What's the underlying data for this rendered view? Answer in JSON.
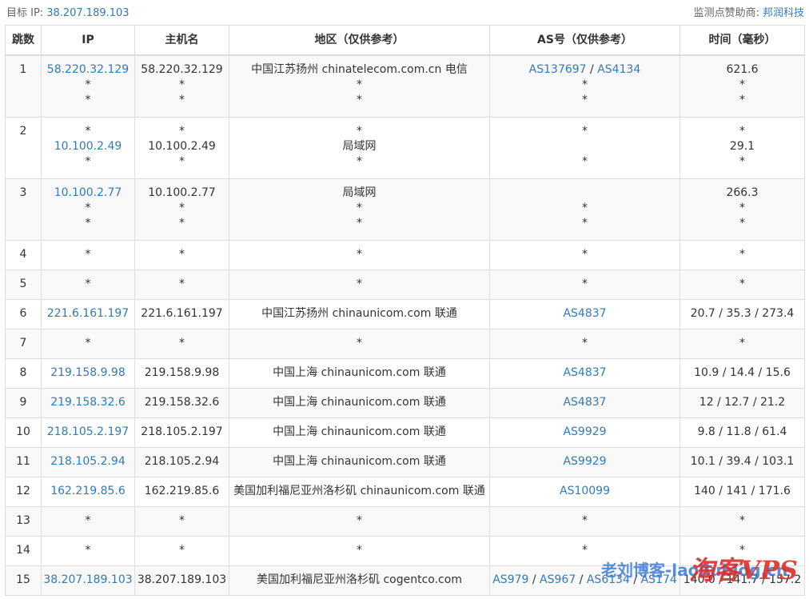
{
  "header": {
    "target_label": "目标 IP:",
    "target_ip": "38.207.189.103",
    "sponsor_label": "监测点赞助商:",
    "sponsor_name": "邦润科技"
  },
  "table": {
    "columns": [
      "跳数",
      "IP",
      "主机名",
      "地区（仅供参考）",
      "AS号（仅供参考）",
      "时间（毫秒）"
    ],
    "rows": [
      {
        "hop": "1",
        "tall": true,
        "ip": [
          {
            "t": "58.220.32.129",
            "l": true
          },
          {
            "t": "*"
          },
          {
            "t": "*"
          }
        ],
        "host": [
          "58.220.32.129",
          "*",
          "*"
        ],
        "region": [
          "中国江苏扬州 chinatelecom.com.cn 电信",
          "*",
          "*"
        ],
        "as": [
          [
            {
              "t": "AS137697",
              "l": true
            },
            {
              "t": "AS4134",
              "l": true
            }
          ],
          [
            {
              "t": "*"
            }
          ],
          [
            {
              "t": "*"
            }
          ]
        ],
        "time": [
          "621.6",
          "*",
          "*"
        ]
      },
      {
        "hop": "2",
        "tall": true,
        "ip": [
          {
            "t": "*"
          },
          {
            "t": "10.100.2.49",
            "l": true
          },
          {
            "t": "*"
          }
        ],
        "host": [
          "*",
          "10.100.2.49",
          "*"
        ],
        "region": [
          "*",
          "局域网",
          "*"
        ],
        "as": [
          [
            {
              "t": "*"
            }
          ],
          [
            {
              "t": ""
            }
          ],
          [
            {
              "t": "*"
            }
          ]
        ],
        "time": [
          "*",
          "29.1",
          "*"
        ]
      },
      {
        "hop": "3",
        "tall": true,
        "ip": [
          {
            "t": "10.100.2.77",
            "l": true
          },
          {
            "t": "*"
          },
          {
            "t": "*"
          }
        ],
        "host": [
          "10.100.2.77",
          "*",
          "*"
        ],
        "region": [
          "局域网",
          "*",
          "*"
        ],
        "as": [
          [
            {
              "t": ""
            }
          ],
          [
            {
              "t": "*"
            }
          ],
          [
            {
              "t": "*"
            }
          ]
        ],
        "time": [
          "266.3",
          "*",
          "*"
        ]
      },
      {
        "hop": "4",
        "ip": [
          {
            "t": "*"
          }
        ],
        "host": [
          "*"
        ],
        "region": [
          "*"
        ],
        "as": [
          [
            {
              "t": "*"
            }
          ]
        ],
        "time": [
          "*"
        ]
      },
      {
        "hop": "5",
        "ip": [
          {
            "t": "*"
          }
        ],
        "host": [
          "*"
        ],
        "region": [
          "*"
        ],
        "as": [
          [
            {
              "t": "*"
            }
          ]
        ],
        "time": [
          "*"
        ]
      },
      {
        "hop": "6",
        "ip": [
          {
            "t": "221.6.161.197",
            "l": true
          }
        ],
        "host": [
          "221.6.161.197"
        ],
        "region": [
          "中国江苏扬州 chinaunicom.com 联通"
        ],
        "as": [
          [
            {
              "t": "AS4837",
              "l": true
            }
          ]
        ],
        "time": [
          "20.7 / 35.3 / 273.4"
        ]
      },
      {
        "hop": "7",
        "ip": [
          {
            "t": "*"
          }
        ],
        "host": [
          "*"
        ],
        "region": [
          "*"
        ],
        "as": [
          [
            {
              "t": "*"
            }
          ]
        ],
        "time": [
          "*"
        ]
      },
      {
        "hop": "8",
        "ip": [
          {
            "t": "219.158.9.98",
            "l": true
          }
        ],
        "host": [
          "219.158.9.98"
        ],
        "region": [
          "中国上海 chinaunicom.com 联通"
        ],
        "as": [
          [
            {
              "t": "AS4837",
              "l": true
            }
          ]
        ],
        "time": [
          "10.9 / 14.4 / 15.6"
        ]
      },
      {
        "hop": "9",
        "ip": [
          {
            "t": "219.158.32.6",
            "l": true
          }
        ],
        "host": [
          "219.158.32.6"
        ],
        "region": [
          "中国上海 chinaunicom.com 联通"
        ],
        "as": [
          [
            {
              "t": "AS4837",
              "l": true
            }
          ]
        ],
        "time": [
          "12 / 12.7 / 21.2"
        ]
      },
      {
        "hop": "10",
        "ip": [
          {
            "t": "218.105.2.197",
            "l": true
          }
        ],
        "host": [
          "218.105.2.197"
        ],
        "region": [
          "中国上海 chinaunicom.com 联通"
        ],
        "as": [
          [
            {
              "t": "AS9929",
              "l": true
            }
          ]
        ],
        "time": [
          "9.8 / 11.8 / 61.4"
        ]
      },
      {
        "hop": "11",
        "ip": [
          {
            "t": "218.105.2.94",
            "l": true
          }
        ],
        "host": [
          "218.105.2.94"
        ],
        "region": [
          "中国上海 chinaunicom.com 联通"
        ],
        "as": [
          [
            {
              "t": "AS9929",
              "l": true
            }
          ]
        ],
        "time": [
          "10.1 / 39.4 / 103.1"
        ]
      },
      {
        "hop": "12",
        "ip": [
          {
            "t": "162.219.85.6",
            "l": true
          }
        ],
        "host": [
          "162.219.85.6"
        ],
        "region": [
          "美国加利福尼亚州洛杉矶 chinaunicom.com 联通"
        ],
        "as": [
          [
            {
              "t": "AS10099",
              "l": true
            }
          ]
        ],
        "time": [
          "140 / 141 / 171.6"
        ]
      },
      {
        "hop": "13",
        "ip": [
          {
            "t": "*"
          }
        ],
        "host": [
          "*"
        ],
        "region": [
          "*"
        ],
        "as": [
          [
            {
              "t": "*"
            }
          ]
        ],
        "time": [
          "*"
        ]
      },
      {
        "hop": "14",
        "ip": [
          {
            "t": "*"
          }
        ],
        "host": [
          "*"
        ],
        "region": [
          "*"
        ],
        "as": [
          [
            {
              "t": "*"
            }
          ]
        ],
        "time": [
          "*"
        ]
      },
      {
        "hop": "15",
        "ip": [
          {
            "t": "38.207.189.103",
            "l": true
          }
        ],
        "host": [
          "38.207.189.103"
        ],
        "region": [
          "美国加利福尼亚州洛杉矶 cogentco.com"
        ],
        "as": [
          [
            {
              "t": "AS979",
              "l": true
            },
            {
              "t": "AS967",
              "l": true
            },
            {
              "t": "AS6134",
              "l": true
            },
            {
              "t": "AS174",
              "l": true
            }
          ]
        ],
        "time": [
          "140.0 / 141.7 / 157.2"
        ]
      }
    ]
  },
  "watermark": {
    "text_blue": "老刘博客-laoliublog.cn",
    "text_red": "淘客VPS"
  },
  "colors": {
    "link": "#337ab7",
    "border": "#dddddd",
    "stripe": "#f9f9f9",
    "watermark_red": "#d9302a"
  }
}
